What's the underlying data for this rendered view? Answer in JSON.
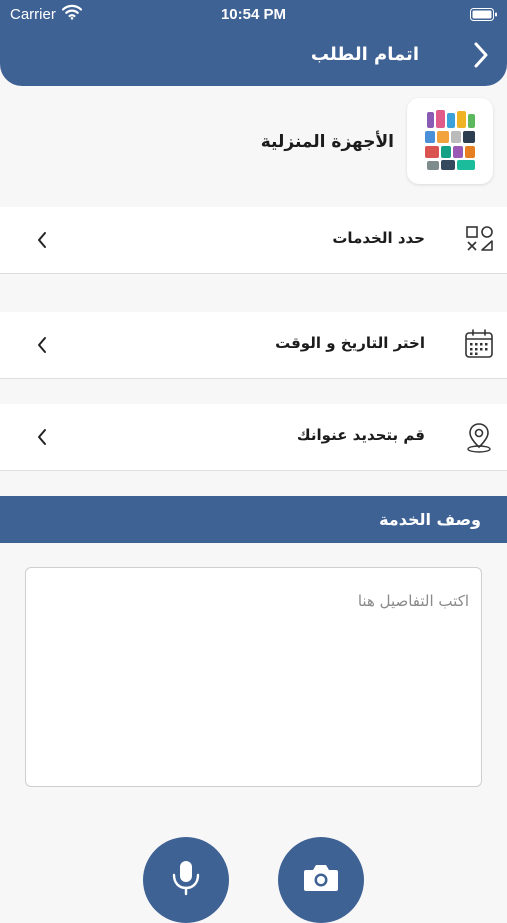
{
  "status_bar": {
    "carrier": "Carrier",
    "time": "10:54 PM"
  },
  "header": {
    "title": "اتمام الطلب"
  },
  "category": {
    "name": "الأجهزة المنزلية"
  },
  "rows": [
    {
      "label": "حدد الخدمات",
      "icon": "services-shapes-icon"
    },
    {
      "label": "اختر التاريخ و الوقت",
      "icon": "calendar-icon"
    },
    {
      "label": "قم بتحديد عنوانك",
      "icon": "location-pin-icon"
    }
  ],
  "description": {
    "title": "وصف الخدمة",
    "placeholder": "اكتب التفاصيل هنا",
    "value": ""
  },
  "actions": {
    "mic_icon": "microphone-icon",
    "camera_icon": "camera-icon"
  },
  "colors": {
    "primary": "#3f6295",
    "background": "#f7f7f7",
    "row": "#ffffff"
  }
}
